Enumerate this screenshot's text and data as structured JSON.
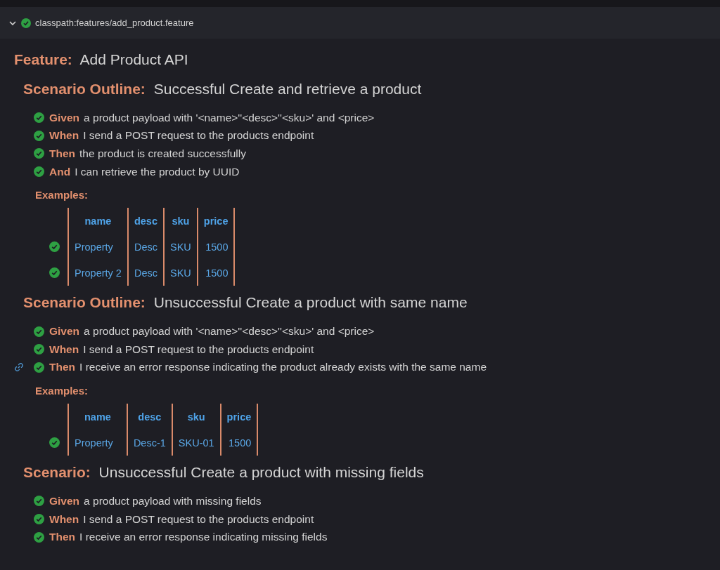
{
  "header": {
    "expanded": true,
    "passed": true,
    "title": "classpath:features/add_product.feature"
  },
  "feature": {
    "keyword": "Feature:",
    "name": "Add Product API"
  },
  "scenarios": [
    {
      "keyword": "Scenario Outline:",
      "name": "Successful Create and retrieve a product",
      "steps": [
        {
          "keyword": "Given",
          "text": "a product payload with '<name>''<desc>''<sku>' and <price>",
          "passed": true,
          "linked": false
        },
        {
          "keyword": "When",
          "text": "I send a POST request to the products endpoint",
          "passed": true,
          "linked": false
        },
        {
          "keyword": "Then",
          "text": "the product is created successfully",
          "passed": true,
          "linked": false
        },
        {
          "keyword": "And",
          "text": "I can retrieve the product by UUID",
          "passed": true,
          "linked": false
        }
      ],
      "examples": {
        "keyword": "Examples:",
        "columns": [
          "name",
          "desc",
          "sku",
          "price"
        ],
        "rows": [
          {
            "passed": true,
            "cells": [
              "Property",
              "Desc",
              "SKU",
              "1500"
            ]
          },
          {
            "passed": true,
            "cells": [
              "Property 2",
              "Desc",
              "SKU",
              "1500"
            ]
          }
        ]
      }
    },
    {
      "keyword": "Scenario Outline:",
      "name": "Unsuccessful Create a product with same name",
      "steps": [
        {
          "keyword": "Given",
          "text": "a product payload with '<name>''<desc>''<sku>' and <price>",
          "passed": true,
          "linked": false
        },
        {
          "keyword": "When",
          "text": "I send a POST request to the products endpoint",
          "passed": true,
          "linked": false
        },
        {
          "keyword": "Then",
          "text": "I receive an error response indicating the product already exists with the same name",
          "passed": true,
          "linked": true
        }
      ],
      "examples": {
        "keyword": "Examples:",
        "columns": [
          "name",
          "desc",
          "sku",
          "price"
        ],
        "rows": [
          {
            "passed": true,
            "cells": [
              "Property",
              "Desc-1",
              "SKU-01",
              "1500"
            ]
          }
        ]
      }
    },
    {
      "keyword": "Scenario:",
      "name": "Unsuccessful Create a product with missing fields",
      "steps": [
        {
          "keyword": "Given",
          "text": "a product payload with missing fields",
          "passed": true,
          "linked": false
        },
        {
          "keyword": "When",
          "text": "I send a POST request to the products endpoint",
          "passed": true,
          "linked": false
        },
        {
          "keyword": "Then",
          "text": "I receive an error response indicating missing fields",
          "passed": true,
          "linked": false
        }
      ]
    }
  ]
}
